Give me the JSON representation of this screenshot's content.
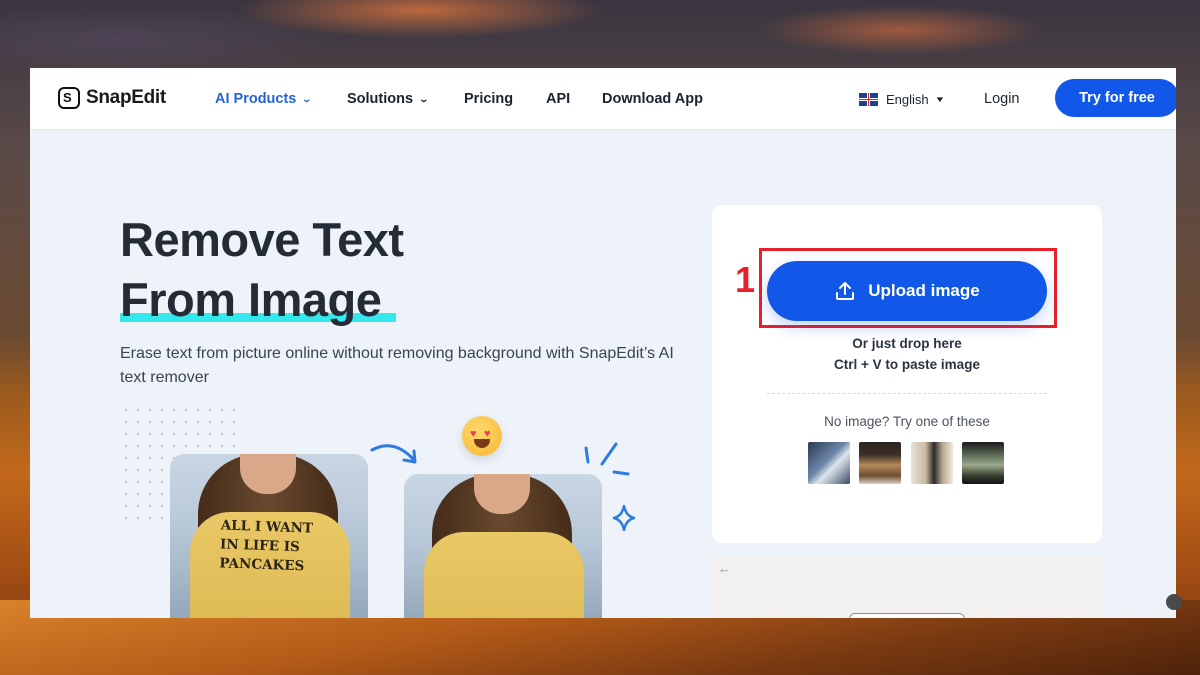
{
  "nav": {
    "logo_text": "SnapEdit",
    "logo_glyph": "S",
    "items": [
      {
        "label": "AI Products",
        "has_dropdown": true,
        "active": true
      },
      {
        "label": "Solutions",
        "has_dropdown": true,
        "active": false
      },
      {
        "label": "Pricing",
        "has_dropdown": false,
        "active": false
      },
      {
        "label": "API",
        "has_dropdown": false,
        "active": false
      },
      {
        "label": "Download App",
        "has_dropdown": false,
        "active": false
      }
    ],
    "language": "English",
    "login_label": "Login",
    "cta_label": "Try for free"
  },
  "hero": {
    "title_line1": "Remove Text",
    "title_line2": "From Image",
    "description": "Erase text from picture online without removing background with SnapEdit’s AI text remover",
    "before_shirt_text": [
      "ALL I WANT",
      "IN LIFE IS",
      "PANCAKES"
    ]
  },
  "upload_panel": {
    "upload_label": "Upload image",
    "drop_hint": "Or just drop here",
    "paste_hint": "Ctrl + V to paste image",
    "sample_prompt": "No image? Try one of these",
    "annotation_step": "1",
    "sample_count": 4
  },
  "preview_panel": {
    "back_arrow": "←"
  },
  "colors": {
    "primary": "#1258e8",
    "accent_underline": "#34e8ec",
    "annotation_red": "#e8202a",
    "active_nav": "#2563d8"
  },
  "icons": [
    "upload-icon",
    "chevron-down-icon",
    "uk-flag-icon",
    "heart-eyes-emoji-icon",
    "sparkle-icon",
    "curved-arrow-icon"
  ]
}
